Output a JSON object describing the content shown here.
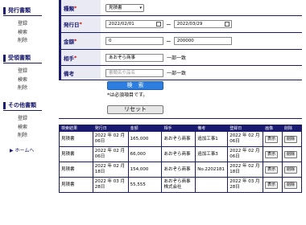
{
  "sidebar": {
    "sections": [
      {
        "title": "発行書類",
        "items": [
          "登録",
          "検索",
          "削除"
        ]
      },
      {
        "title": "受領書類",
        "items": [
          "登録",
          "検索",
          "削除"
        ]
      },
      {
        "title": "その他書類",
        "items": [
          "登録",
          "検索",
          "削除"
        ]
      }
    ],
    "home_label": "▶ ホームへ"
  },
  "form": {
    "type": {
      "label": "種類",
      "required": "*",
      "value": "見積書",
      "arrow": "▾"
    },
    "issue_date": {
      "label": "発行日",
      "required": "*",
      "from": "2022/02/01",
      "tilde": "~",
      "to": "2022/03/29"
    },
    "amount": {
      "label": "金額",
      "required": "*",
      "from": "0",
      "tilde": "~",
      "to": "200000"
    },
    "partner": {
      "label": "相手",
      "required": "*",
      "value": "あおぞら商事",
      "note": "一部一致"
    },
    "remarks": {
      "label": "備考",
      "placeholder": "書類名や品名",
      "note": "一部一致"
    },
    "search_button": "検　索",
    "required_note": "*は必須項目です。",
    "reset_button": "リセット"
  },
  "results": {
    "headers": [
      "検索結果",
      "発行日",
      "金額",
      "相手",
      "備考",
      "登録日",
      "画像",
      "削除"
    ],
    "rows": [
      {
        "type": "見積書",
        "issue_date": "2022 年 02 月 06日",
        "amount": "165,000",
        "partner": "あおぞら商事",
        "remarks": "追加工事1",
        "registered": "2022 年 02 月 06日",
        "view": "表示",
        "delete": "削除"
      },
      {
        "type": "見積書",
        "issue_date": "2022 年 02 月 06日",
        "amount": "66,000",
        "partner": "あおぞら商事",
        "remarks": "追加工事3",
        "registered": "2022 年 02 月 06日",
        "view": "表示",
        "delete": "削除"
      },
      {
        "type": "見積書",
        "issue_date": "2022 年 02 月 18日",
        "amount": "154,000",
        "partner": "あおぞら商事",
        "remarks": "No.2202181",
        "registered": "2022 年 02 月 18日",
        "view": "表示",
        "delete": "削除"
      },
      {
        "type": "見積書",
        "issue_date": "2022 年 03 月 28日",
        "amount": "55,555",
        "partner": "あおぞら商事株式会社",
        "remarks": "",
        "registered": "2022 年 03 月 28日",
        "view": "表示",
        "delete": "削除"
      }
    ]
  },
  "colors": {
    "navy": "#1a1a6e",
    "search_button": "#2e7ee0",
    "required": "#cc0000",
    "label_bg": "#e9eaf3"
  }
}
